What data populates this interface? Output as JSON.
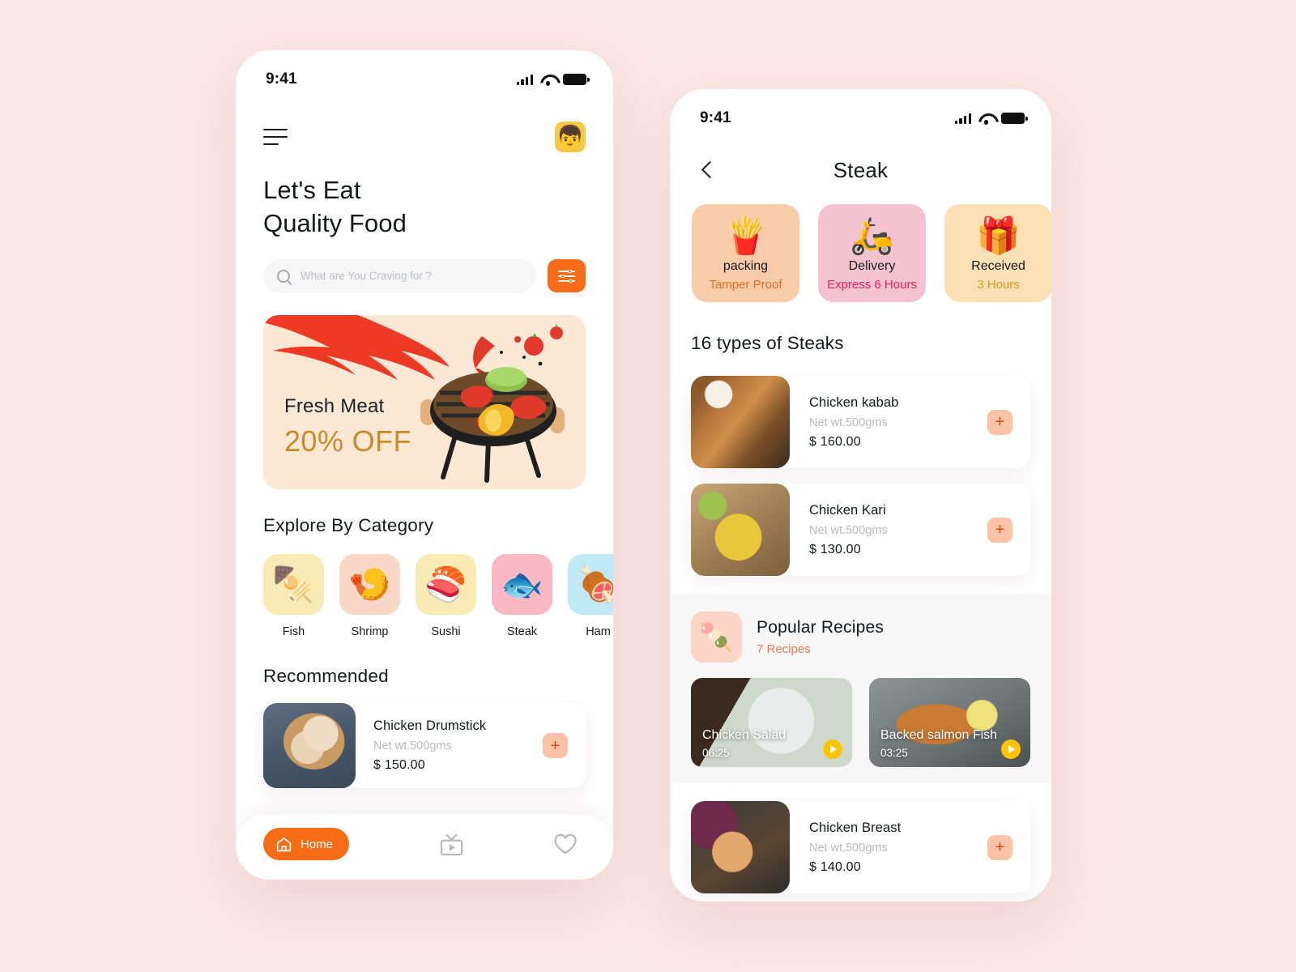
{
  "background_color": "#FBE7E6",
  "accent_color": "#F96C17",
  "home": {
    "status": {
      "time": "9:41",
      "signal_icon": "signal-icon",
      "wifi_icon": "wifi-icon",
      "battery_icon": "battery-icon"
    },
    "menu_icon": "hamburger-menu-icon",
    "avatar_icon": "👦",
    "title_line1": "Let's Eat",
    "title_line2": "Quality Food",
    "search": {
      "placeholder": "What are You Craving for ?",
      "value": "",
      "icon": "search-icon"
    },
    "filter_icon": "filter-sliders-icon",
    "promo": {
      "title": "Fresh Meat",
      "discount": "20% OFF",
      "bg": "#FBE8D4",
      "discount_color": "#C98B2A"
    },
    "category_section_title": "Explore By Category",
    "categories": [
      {
        "label": "Fish",
        "emoji": "🍢",
        "bg": "#F7EAB4"
      },
      {
        "label": "Shrimp",
        "emoji": "🍤",
        "bg": "#F9D7C6"
      },
      {
        "label": "Sushi",
        "emoji": "🍣",
        "bg": "#F7EAB4"
      },
      {
        "label": "Steak",
        "emoji": "🐟",
        "bg": "#F9B8C4"
      },
      {
        "label": "Ham",
        "emoji": "🍖",
        "bg": "#BFEAF5"
      }
    ],
    "recommended_title": "Recommended",
    "recommended": [
      {
        "name": "Chicken Drumstick",
        "net": "Net wt.500gms",
        "price": "$ 150.00",
        "add_label": "+",
        "img": "img-drumstick"
      }
    ],
    "nav": {
      "home_label": "Home",
      "home_icon": "home-icon",
      "video_icon": "tv-video-icon",
      "favorite_icon": "heart-icon"
    }
  },
  "steak": {
    "status": {
      "time": "9:41",
      "signal_icon": "signal-icon",
      "wifi_icon": "wifi-icon",
      "battery_icon": "battery-icon"
    },
    "back_icon": "chevron-left-icon",
    "title": "Steak",
    "chips": [
      {
        "title": "packing",
        "sub": "Tamper Proof",
        "emoji": "🍟",
        "bg": "#F8CBA9",
        "sub_color": "#E2702A"
      },
      {
        "title": "Delivery",
        "sub": "Express 6 Hours",
        "emoji": "🛵",
        "bg": "#F4C3D2",
        "sub_color": "#E8215B"
      },
      {
        "title": "Received",
        "sub": "3 Hours",
        "emoji": "🎁",
        "bg": "#FBDFB5",
        "sub_color": "#D59A26"
      }
    ],
    "list_title": "16 types of Steaks",
    "products": [
      {
        "name": "Chicken kabab",
        "net": "Net wt.500gms",
        "price": "$ 160.00",
        "add_label": "+",
        "img": "img-kabab"
      },
      {
        "name": "Chicken Kari",
        "net": "Net wt.500gms",
        "price": "$ 130.00",
        "add_label": "+",
        "img": "img-kari"
      }
    ],
    "products_below": [
      {
        "name": "Chicken Breast",
        "net": "Net wt.500gms",
        "price": "$ 140.00",
        "add_label": "+",
        "img": "img-breast"
      }
    ],
    "recipes": {
      "icon_emoji": "🍡",
      "title": "Popular Recipes",
      "count": "7 Recipes",
      "items": [
        {
          "name": "Chicken Salad",
          "time": "06:25",
          "play_icon": "play-icon",
          "img": "img-salad"
        },
        {
          "name": "Backed salmon Fish",
          "time": "03:25",
          "play_icon": "play-icon",
          "img": "img-salmon"
        }
      ]
    }
  }
}
